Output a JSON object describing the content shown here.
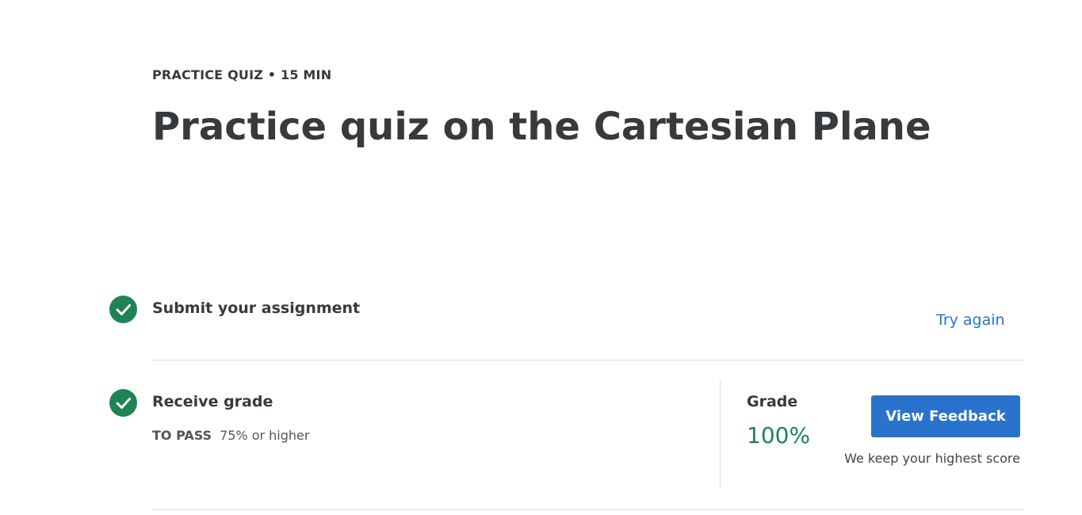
{
  "header": {
    "eyebrow": "PRACTICE QUIZ • 15 MIN",
    "title": "Practice quiz on the Cartesian Plane"
  },
  "steps": [
    {
      "title": "Submit your assignment",
      "status_icon": "check-circle-icon",
      "action_label": "Try again"
    },
    {
      "title": "Receive grade",
      "status_icon": "check-circle-icon",
      "pass_label": "TO PASS",
      "pass_value": "75% or higher"
    }
  ],
  "grade": {
    "label": "Grade",
    "value": "100%",
    "button_label": "View Feedback",
    "note": "We keep your highest score"
  },
  "colors": {
    "accent": "#2a73cc",
    "success": "#1f8354",
    "text": "#373a3c"
  }
}
